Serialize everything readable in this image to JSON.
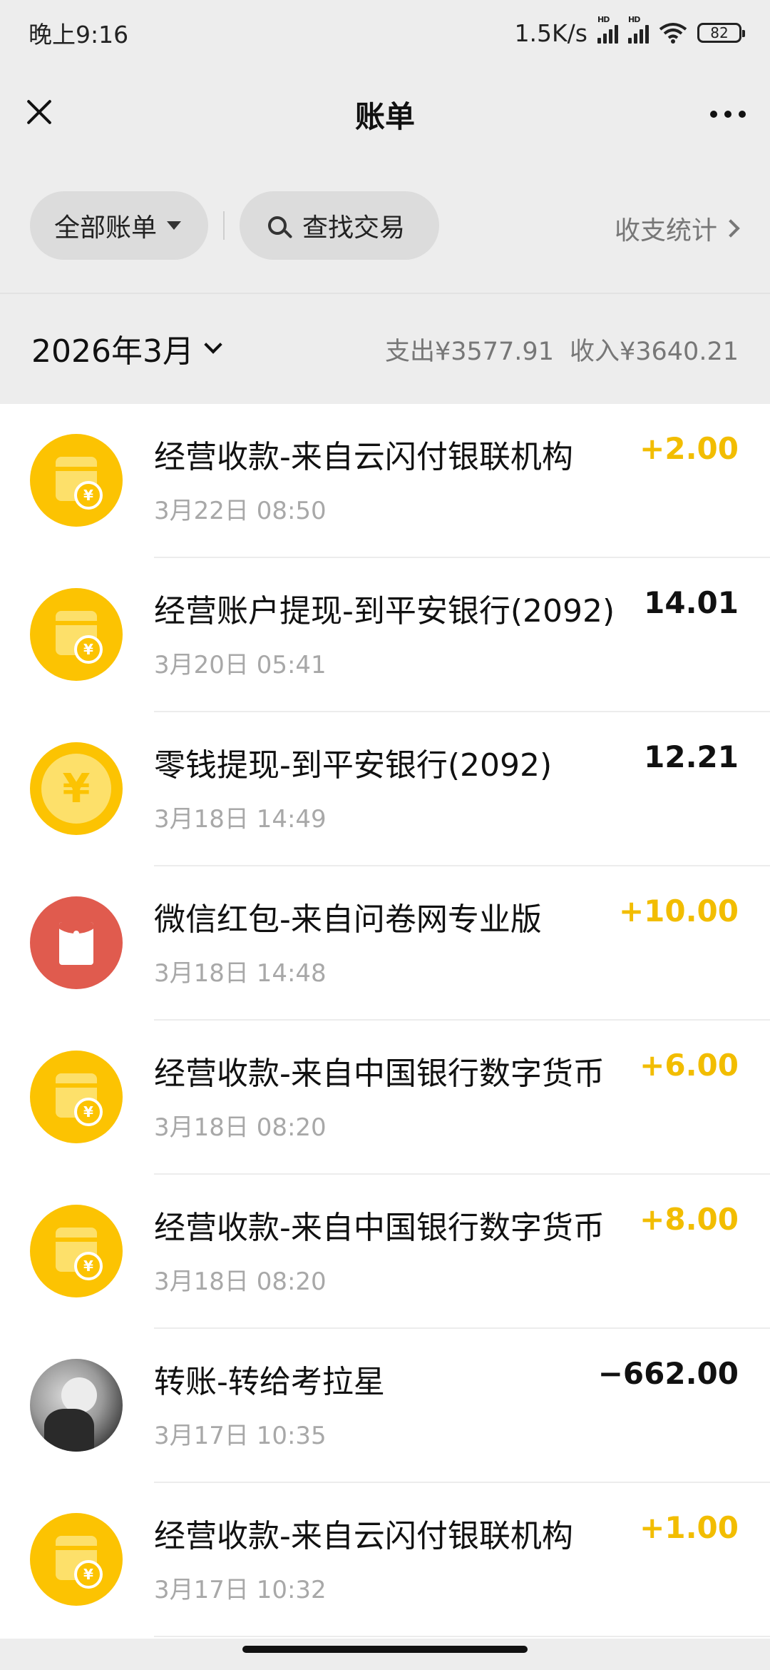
{
  "status_bar": {
    "time": "晚上9:16",
    "network_speed": "1.5K/s",
    "signal1_label": "HD",
    "signal2_label": "HD",
    "battery": "82"
  },
  "header": {
    "title": "账单"
  },
  "filters": {
    "all_bills": "全部账单",
    "search": "查找交易",
    "stats": "收支统计"
  },
  "summary": {
    "month": "2026年3月",
    "expense": "支出¥3577.91",
    "income": "收入¥3640.21"
  },
  "transactions": [
    {
      "name": "经营收款-来自云闪付银联机构",
      "time": "3月22日 08:50",
      "amount": "+2.00",
      "icon": "shop-icon",
      "type": "income"
    },
    {
      "name": "经营账户提现-到平安银行(2092)",
      "time": "3月20日 05:41",
      "amount": "14.01",
      "icon": "shop-icon",
      "type": "expense"
    },
    {
      "name": "零钱提现-到平安银行(2092)",
      "time": "3月18日 14:49",
      "amount": "12.21",
      "icon": "yuan-coin-icon",
      "type": "expense"
    },
    {
      "name": "微信红包-来自问卷网专业版",
      "time": "3月18日 14:48",
      "amount": "+10.00",
      "icon": "red-packet-icon",
      "type": "income"
    },
    {
      "name": "经营收款-来自中国银行数字货币",
      "time": "3月18日 08:20",
      "amount": "+6.00",
      "icon": "shop-icon",
      "type": "income"
    },
    {
      "name": "经营收款-来自中国银行数字货币",
      "time": "3月18日 08:20",
      "amount": "+8.00",
      "icon": "shop-icon",
      "type": "income"
    },
    {
      "name": "转账-转给考拉星",
      "time": "3月17日 10:35",
      "amount": "−662.00",
      "icon": "avatar",
      "type": "expense"
    },
    {
      "name": "经营收款-来自云闪付银联机构",
      "time": "3月17日 10:32",
      "amount": "+1.00",
      "icon": "shop-icon",
      "type": "income"
    }
  ],
  "colors": {
    "income": "#f2bd00",
    "shop_icon_bg": "#fcc302",
    "red_packet_bg": "#e05b4e"
  }
}
